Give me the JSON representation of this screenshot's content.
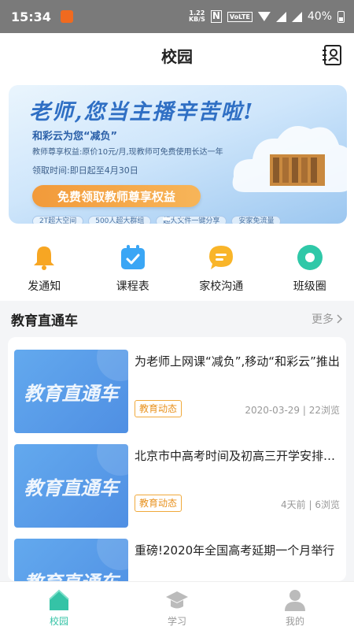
{
  "status_bar": {
    "time": "15:34",
    "speed_value": "1.22",
    "speed_unit": "KB/S",
    "nfc": "N",
    "volte": "VoLTE",
    "battery": "40%"
  },
  "header": {
    "title": "校园",
    "icon": "contacts-icon"
  },
  "banner": {
    "headline": "老师,您当主播辛苦啦!",
    "subline": "和彩云为您“减负”",
    "benefit": "教师尊享权益:原价10元/月,现教师可免费使用长达一年",
    "period": "领取时间:即日起至4月30日",
    "cta": "免费领取教师尊享权益",
    "chips": [
      "2T超大空间",
      "500人超大群组",
      "超大文件一键分享",
      "安家免流量"
    ]
  },
  "quick_actions": [
    {
      "label": "发通知",
      "icon": "bell-icon",
      "color": "#f7a623"
    },
    {
      "label": "课程表",
      "icon": "calendar-icon",
      "color": "#3aa6f5"
    },
    {
      "label": "家校沟通",
      "icon": "chat-icon",
      "color": "#f9b529"
    },
    {
      "label": "班级圈",
      "icon": "circle-icon",
      "color": "#2fc8a8"
    }
  ],
  "section": {
    "title": "教育直通车",
    "more": "更多"
  },
  "news": [
    {
      "thumb_text": "教育直通车",
      "title": "为老师上网课“减负”,移动“和彩云”推出",
      "tag": "教育动态",
      "meta": "2020-03-29 | 22浏览"
    },
    {
      "thumb_text": "教育直通车",
      "title": "北京市中高考时间及初高三开学安排公布",
      "tag": "教育动态",
      "meta": "4天前 | 6浏览"
    },
    {
      "thumb_text": "教育直通车",
      "title": "重磅!2020年全国高考延期一个月举行",
      "tag": "",
      "meta": ""
    }
  ],
  "tabs": [
    {
      "label": "校园",
      "icon": "home-icon",
      "active": true
    },
    {
      "label": "学习",
      "icon": "graduation-cap-icon",
      "active": false
    },
    {
      "label": "我的",
      "icon": "user-icon",
      "active": false
    }
  ],
  "colors": {
    "accent": "#35c3a6",
    "tag": "#e8921f",
    "banner_cta": "#f29a3a"
  }
}
